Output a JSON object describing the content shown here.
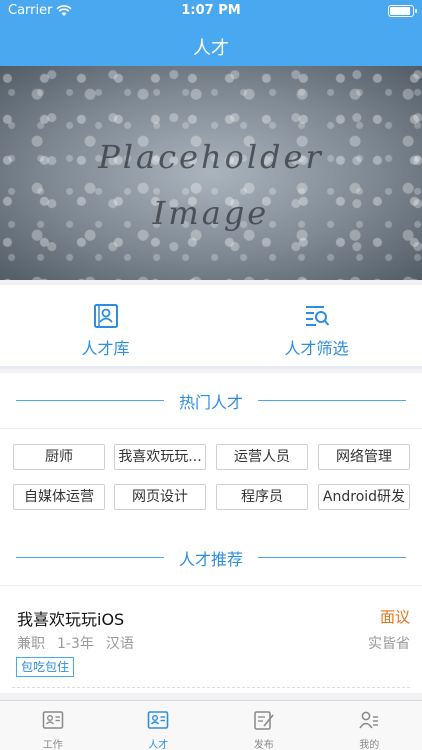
{
  "status_bar": {
    "carrier": "Carrier",
    "time": "1:07 PM"
  },
  "nav": {
    "title": "人才"
  },
  "banner": {
    "line1": "Placeholder",
    "line2": "Image"
  },
  "entries": [
    {
      "label": "人才库",
      "icon": "contact-card-icon"
    },
    {
      "label": "人才筛选",
      "icon": "filter-search-icon"
    }
  ],
  "hot_section": {
    "title": "热门人才"
  },
  "tags": [
    "厨师",
    "我喜欢玩玩...",
    "运营人员",
    "网络管理",
    "自媒体运营",
    "网页设计",
    "程序员",
    "Android研发"
  ],
  "recommend_section": {
    "title": "人才推荐"
  },
  "card": {
    "name": "我喜欢玩玩iOS",
    "salary": "面议",
    "type": "兼职",
    "experience": "1-3年",
    "language": "汉语",
    "location": "实皆省",
    "perk": "包吃包住"
  },
  "tabbar": [
    {
      "label": "工作",
      "icon": "id-card-icon",
      "active": false
    },
    {
      "label": "人才",
      "icon": "talent-card-icon",
      "active": true
    },
    {
      "label": "发布",
      "icon": "edit-note-icon",
      "active": false
    },
    {
      "label": "我的",
      "icon": "profile-list-icon",
      "active": false
    }
  ],
  "colors": {
    "accent": "#4aa8f0",
    "accent_text": "#2d8ee0",
    "salary": "#e8731d"
  }
}
